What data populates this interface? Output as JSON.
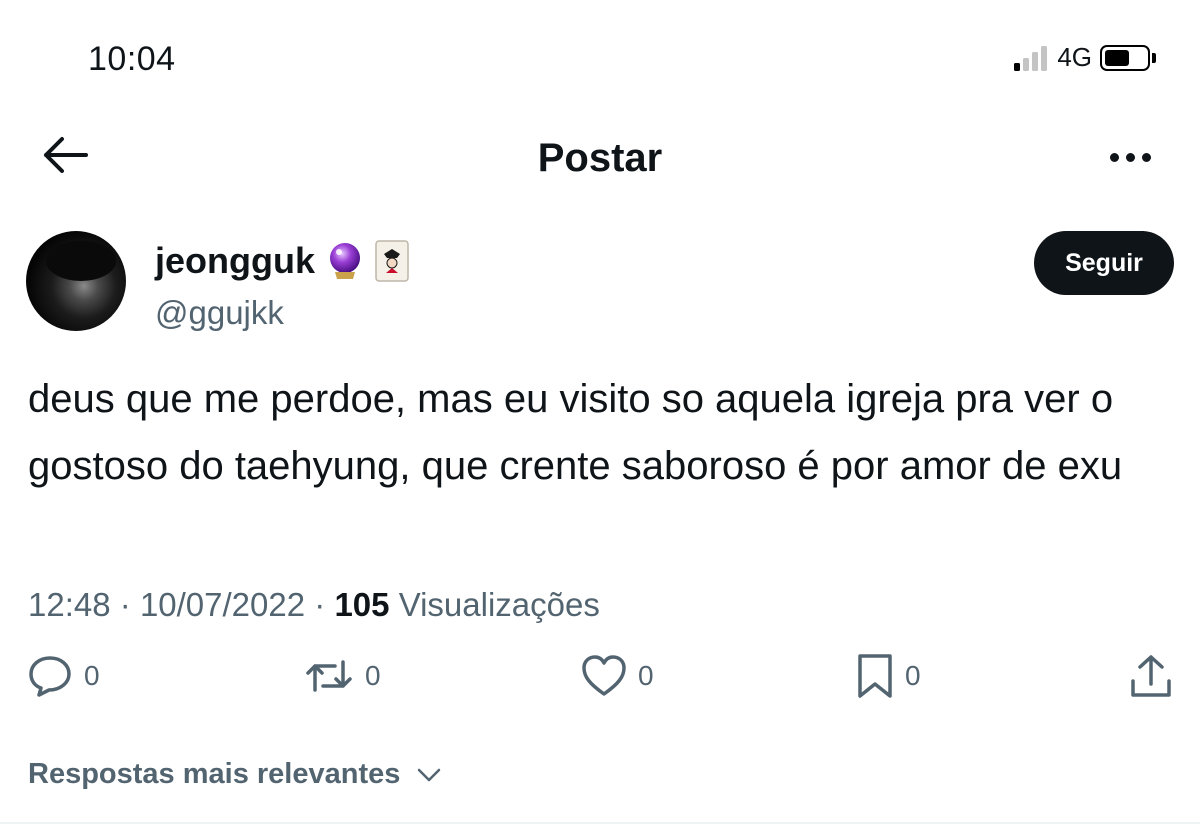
{
  "status_bar": {
    "time": "10:04",
    "network": "4G"
  },
  "nav": {
    "title": "Postar"
  },
  "tweet": {
    "author": {
      "display_name": "jeongguk",
      "handle": "@ggujkk",
      "name_emojis": [
        "crystal-ball",
        "joker-card"
      ]
    },
    "follow_label": "Seguir",
    "text": "deus que me perdoe, mas eu visito so aquela igreja pra ver o gostoso do taehyung, que crente saboroso é por amor de exu",
    "time": "12:48",
    "separator": "·",
    "date": "10/07/2022",
    "views_count": "105",
    "views_label": "Visualizações",
    "actions": {
      "replies": "0",
      "reposts": "0",
      "likes": "0",
      "bookmarks": "0"
    }
  },
  "replies_sort": {
    "label": "Respostas mais relevantes"
  },
  "colors": {
    "text": "#0f1419",
    "secondary": "#536471",
    "follow_bg": "#0f1419"
  },
  "icons": [
    "back-arrow-icon",
    "more-icon",
    "reply-icon",
    "repost-icon",
    "like-icon",
    "bookmark-icon",
    "share-icon",
    "chevron-down-icon"
  ]
}
